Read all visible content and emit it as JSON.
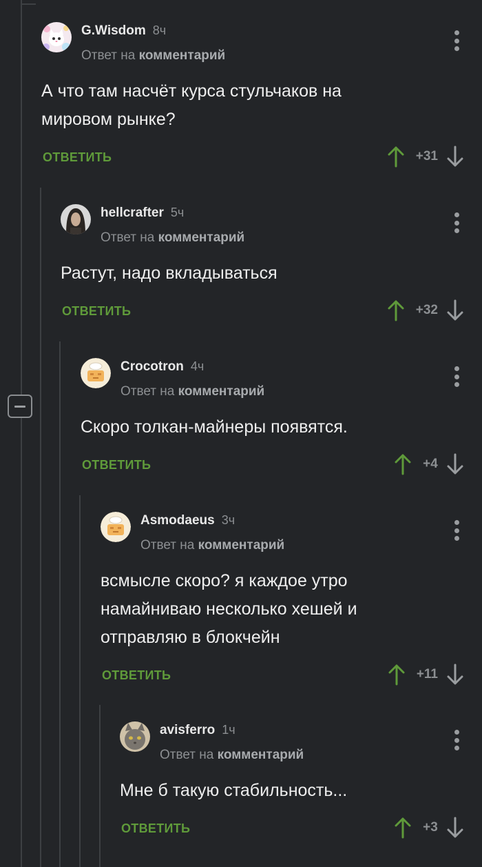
{
  "collapse_label": "−",
  "comments": [
    {
      "author": "G.Wisdom",
      "time": "8ч",
      "reply_prefix": "Ответ на",
      "reply_target": "комментарий",
      "text": "А что там насчёт курса стульчаков на мировом рынке?",
      "reply_label": "ОТВЕТИТЬ",
      "score": "+31",
      "avatar_icon": "kitten-avatar-icon"
    },
    {
      "author": "hellcrafter",
      "time": "5ч",
      "reply_prefix": "Ответ на",
      "reply_target": "комментарий",
      "text": "Растут, надо вкладываться",
      "reply_label": "ОТВЕТИТЬ",
      "score": "+32",
      "avatar_icon": "person-photo-avatar-icon"
    },
    {
      "author": "Crocotron",
      "time": "4ч",
      "reply_prefix": "Ответ на",
      "reply_target": "комментарий",
      "text": "Скоро толкан-майнеры появятся.",
      "reply_label": "ОТВЕТИТЬ",
      "score": "+4",
      "avatar_icon": "default-chef-avatar-icon"
    },
    {
      "author": "Asmodaeus",
      "time": "3ч",
      "reply_prefix": "Ответ на",
      "reply_target": "комментарий",
      "text": "всмысле скоро? я каждое утро намайниваю несколько хешей и отправляю в блокчейн",
      "reply_label": "ОТВЕТИТЬ",
      "score": "+11",
      "avatar_icon": "default-chef-avatar-icon"
    },
    {
      "author": "avisferro",
      "time": "1ч",
      "reply_prefix": "Ответ на",
      "reply_target": "комментарий",
      "text": "Мне б такую стабильность...",
      "reply_label": "ОТВЕТИТЬ",
      "score": "+3",
      "avatar_icon": "cat-photo-avatar-icon"
    }
  ],
  "colors": {
    "background": "#232528",
    "reply_green": "#5f9a3a",
    "upvote_green": "#5f9a3a",
    "muted": "#8c8f92"
  }
}
